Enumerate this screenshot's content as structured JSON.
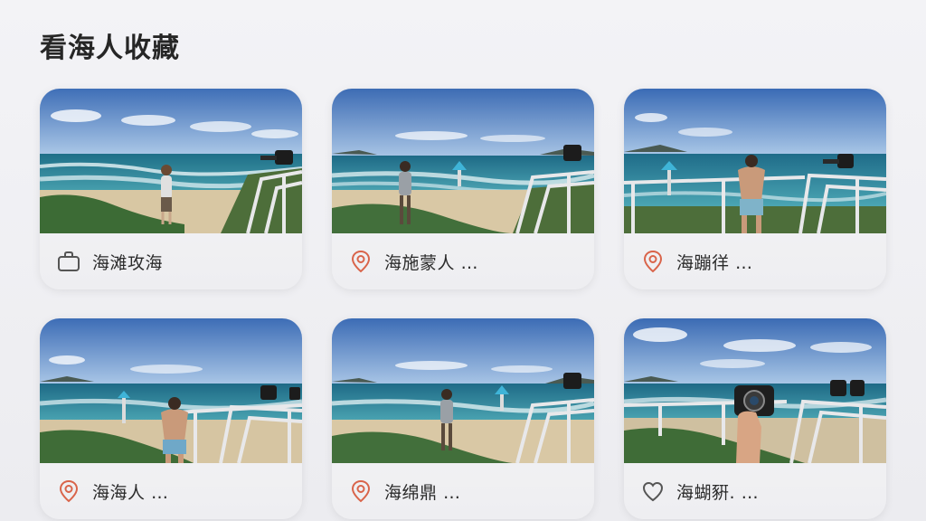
{
  "page": {
    "title": "看海人收藏"
  },
  "cards": [
    {
      "label": "海滩攻海",
      "icon": "briefcase-icon"
    },
    {
      "label": "海施蒙人 …",
      "icon": "location-pin-icon"
    },
    {
      "label": "海蹦徉 …",
      "icon": "location-pin-icon"
    },
    {
      "label": "海海人 …",
      "icon": "location-pin-icon"
    },
    {
      "label": "海绵鼎 …",
      "icon": "location-pin-icon"
    },
    {
      "label": "海蝴豣. …",
      "icon": "heart-icon"
    }
  ],
  "colors": {
    "pin": "#d9644a",
    "icon_outline": "#555555"
  }
}
